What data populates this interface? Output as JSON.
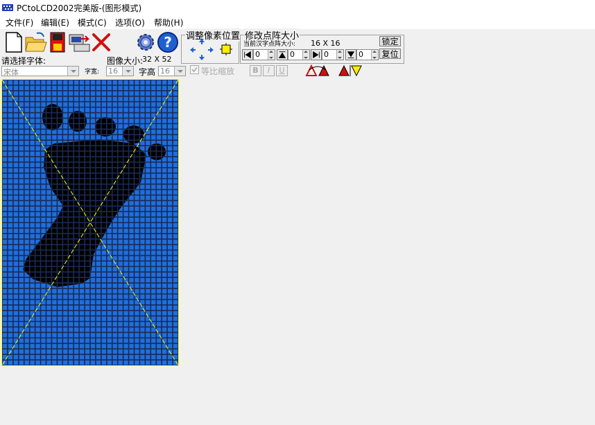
{
  "window": {
    "title": "PCtoLCD2002完美版-(图形模式)"
  },
  "menu": [
    "文件(F)",
    "编辑(E)",
    "模式(C)",
    "选项(O)",
    "帮助(H)"
  ],
  "toolbar": {
    "buttons": [
      "new-icon",
      "open-folder-icon",
      "save-icon",
      "export-icon",
      "close-x-icon",
      "settings-gear-icon",
      "help-icon"
    ]
  },
  "pixel_adjust": {
    "label": "调整像素位置"
  },
  "matrix": {
    "label": "修改点阵大小",
    "current_label": "当前汉字点阵大小:",
    "current_size": "16  X  16",
    "lock_button": "锁定",
    "reset_button": "复位",
    "offsets": [
      "0",
      "0",
      "0",
      "0"
    ]
  },
  "font": {
    "prompt": "请选择字体:",
    "selected": "宋体",
    "width_label": "字宽:",
    "width_value": "16",
    "height_label": "字高",
    "height_value": "16",
    "proportional_label": "等比缩放"
  },
  "image": {
    "size_label": "图像大小:",
    "size_value": "32  X  52"
  },
  "format_buttons": [
    "B",
    "I",
    "U"
  ],
  "canvas": {
    "grid_cols": 32,
    "grid_rows": 52,
    "bg": "#1f6fdc",
    "pixel_on": "#000000",
    "border": "#ffff00"
  }
}
